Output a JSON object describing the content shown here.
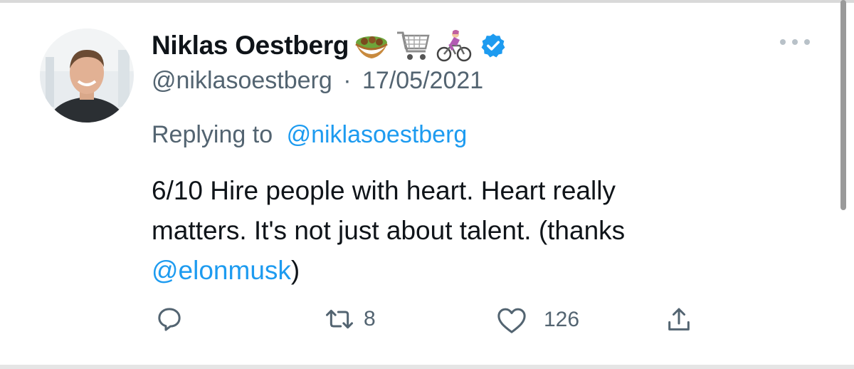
{
  "tweet": {
    "author": {
      "display_name": "Niklas Oestberg",
      "name_emojis": [
        "falafel-icon",
        "shopping-cart-icon",
        "cyclist-icon"
      ],
      "verified": true,
      "handle": "@niklasoestberg"
    },
    "separator": "·",
    "date": "17/05/2021",
    "replying_prefix": "Replying to",
    "replying_to": "@niklasoestberg",
    "text_lines": [
      "6/10 Hire people with heart. Heart really",
      "matters. It's not just about talent. (thanks"
    ],
    "mention": "@elonmusk",
    "mention_suffix": ")",
    "actions": {
      "reply_count": "",
      "retweet_count": "8",
      "like_count": "126"
    }
  },
  "colors": {
    "text": "#0f1419",
    "secondary": "#536471",
    "link": "#1d9bf0",
    "verified": "#1d9bf0"
  }
}
